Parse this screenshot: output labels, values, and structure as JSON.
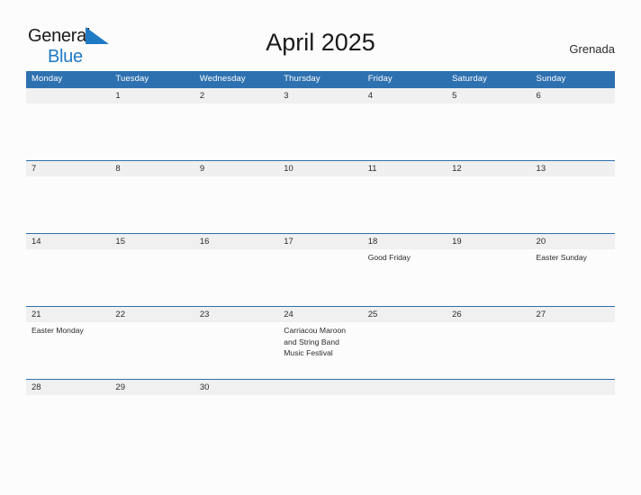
{
  "brand": {
    "name_part1": "General",
    "name_part2": "Blue",
    "flag_icon": "blue-triangle-flag-icon",
    "color_dark": "#1a1a1a",
    "color_blue": "#1f7ac4"
  },
  "header": {
    "title": "April 2025",
    "country": "Grenada"
  },
  "theme": {
    "header_blue": "#2e71b0",
    "date_band_gray": "#f0f0f0",
    "page_background": "#fcfcfc",
    "text_color": "#2b2b2b"
  },
  "calendar": {
    "month": "April",
    "year": "2025",
    "weekday_headers": [
      "Monday",
      "Tuesday",
      "Wednesday",
      "Thursday",
      "Friday",
      "Saturday",
      "Sunday"
    ],
    "weeks": [
      {
        "days": [
          {
            "num": "",
            "event": ""
          },
          {
            "num": "1",
            "event": ""
          },
          {
            "num": "2",
            "event": ""
          },
          {
            "num": "3",
            "event": ""
          },
          {
            "num": "4",
            "event": ""
          },
          {
            "num": "5",
            "event": ""
          },
          {
            "num": "6",
            "event": ""
          }
        ]
      },
      {
        "days": [
          {
            "num": "7",
            "event": ""
          },
          {
            "num": "8",
            "event": ""
          },
          {
            "num": "9",
            "event": ""
          },
          {
            "num": "10",
            "event": ""
          },
          {
            "num": "11",
            "event": ""
          },
          {
            "num": "12",
            "event": ""
          },
          {
            "num": "13",
            "event": ""
          }
        ]
      },
      {
        "days": [
          {
            "num": "14",
            "event": ""
          },
          {
            "num": "15",
            "event": ""
          },
          {
            "num": "16",
            "event": ""
          },
          {
            "num": "17",
            "event": ""
          },
          {
            "num": "18",
            "event": "Good Friday"
          },
          {
            "num": "19",
            "event": ""
          },
          {
            "num": "20",
            "event": "Easter Sunday"
          }
        ]
      },
      {
        "days": [
          {
            "num": "21",
            "event": "Easter Monday"
          },
          {
            "num": "22",
            "event": ""
          },
          {
            "num": "23",
            "event": ""
          },
          {
            "num": "24",
            "event": "Carriacou Maroon and String Band Music Festival"
          },
          {
            "num": "25",
            "event": ""
          },
          {
            "num": "26",
            "event": ""
          },
          {
            "num": "27",
            "event": ""
          }
        ]
      },
      {
        "days": [
          {
            "num": "28",
            "event": ""
          },
          {
            "num": "29",
            "event": ""
          },
          {
            "num": "30",
            "event": ""
          },
          {
            "num": "",
            "event": ""
          },
          {
            "num": "",
            "event": ""
          },
          {
            "num": "",
            "event": ""
          },
          {
            "num": "",
            "event": ""
          }
        ]
      }
    ]
  }
}
